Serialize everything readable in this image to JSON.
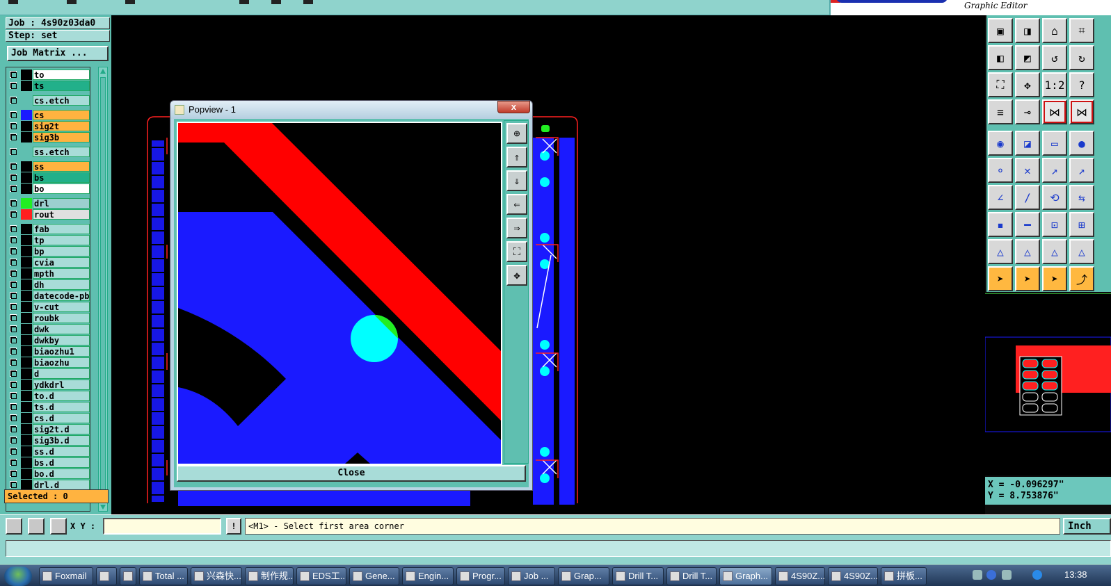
{
  "top": {
    "brand_sub": "Graphic Editor"
  },
  "left_panel": {
    "job": "Job : 4s90z03da0",
    "step": "Step: set",
    "job_matrix": "Job Matrix ...",
    "selected": "Selected : 0",
    "layers": [
      {
        "name": "to",
        "bg": "#ffffff",
        "swatch": "#000000"
      },
      {
        "name": "ts",
        "bg": "#22b08a",
        "swatch": "#000000"
      },
      {
        "name": "cs.etch",
        "bg": "#a8dcd8",
        "swatch": "#5fbfb0"
      },
      {
        "name": "cs",
        "bg": "#ffb340",
        "swatch": "#1a1aff"
      },
      {
        "name": "sig2t",
        "bg": "#ffb340",
        "swatch": "#000000"
      },
      {
        "name": "sig3b",
        "bg": "#ffb340",
        "swatch": "#000000"
      },
      {
        "name": "ss.etch",
        "bg": "#a8dcd8",
        "swatch": "#5fbfb0"
      },
      {
        "name": "ss",
        "bg": "#ffb340",
        "swatch": "#000000"
      },
      {
        "name": "bs",
        "bg": "#22b08a",
        "swatch": "#000000"
      },
      {
        "name": "bo",
        "bg": "#ffffff",
        "swatch": "#000000"
      },
      {
        "name": "drl",
        "bg": "#9ccfcf",
        "swatch": "#22ee22"
      },
      {
        "name": "rout",
        "bg": "#e0e0e0",
        "swatch": "#ff2020"
      },
      {
        "name": "fab",
        "bg": "#a8dcd8",
        "swatch": "#000000"
      },
      {
        "name": "tp",
        "bg": "#a8dcd8",
        "swatch": "#000000"
      },
      {
        "name": "bp",
        "bg": "#a8dcd8",
        "swatch": "#000000"
      },
      {
        "name": "cvia",
        "bg": "#a8dcd8",
        "swatch": "#000000"
      },
      {
        "name": "mpth",
        "bg": "#a8dcd8",
        "swatch": "#000000"
      },
      {
        "name": "dh",
        "bg": "#a8dcd8",
        "swatch": "#000000"
      },
      {
        "name": "datecode-pbc",
        "bg": "#a8dcd8",
        "swatch": "#000000"
      },
      {
        "name": "v-cut",
        "bg": "#a8dcd8",
        "swatch": "#000000"
      },
      {
        "name": "roubk",
        "bg": "#a8dcd8",
        "swatch": "#000000"
      },
      {
        "name": "dwk",
        "bg": "#a8dcd8",
        "swatch": "#000000"
      },
      {
        "name": "dwkby",
        "bg": "#a8dcd8",
        "swatch": "#000000"
      },
      {
        "name": "biaozhu1",
        "bg": "#a8dcd8",
        "swatch": "#000000"
      },
      {
        "name": "biaozhu",
        "bg": "#a8dcd8",
        "swatch": "#000000"
      },
      {
        "name": "d",
        "bg": "#a8dcd8",
        "swatch": "#000000"
      },
      {
        "name": "ydkdrl",
        "bg": "#a8dcd8",
        "swatch": "#000000"
      },
      {
        "name": "to.d",
        "bg": "#a8dcd8",
        "swatch": "#000000"
      },
      {
        "name": "ts.d",
        "bg": "#a8dcd8",
        "swatch": "#000000"
      },
      {
        "name": "cs.d",
        "bg": "#a8dcd8",
        "swatch": "#000000"
      },
      {
        "name": "sig2t.d",
        "bg": "#a8dcd8",
        "swatch": "#000000"
      },
      {
        "name": "sig3b.d",
        "bg": "#a8dcd8",
        "swatch": "#000000"
      },
      {
        "name": "ss.d",
        "bg": "#a8dcd8",
        "swatch": "#000000"
      },
      {
        "name": "bs.d",
        "bg": "#a8dcd8",
        "swatch": "#000000"
      },
      {
        "name": "bo.d",
        "bg": "#a8dcd8",
        "swatch": "#000000"
      },
      {
        "name": "drl.d",
        "bg": "#a8dcd8",
        "swatch": "#000000"
      }
    ]
  },
  "popview": {
    "title": "Popview - 1",
    "close_x": "x",
    "close_button": "Close"
  },
  "right_panel": {
    "coord_x": "X = -0.096297\"",
    "coord_y": "Y = 8.753876\""
  },
  "command": {
    "xy_label": "X Y :",
    "xy_value": "",
    "excl": "!",
    "prompt": "<M1> - Select first area corner",
    "units": "Inch"
  },
  "taskbar": {
    "items": [
      "Foxmail",
      "",
      "",
      "Total ...",
      "兴森快...",
      "制作规...",
      "EDS工...",
      "Gene...",
      "Engin...",
      "Progr...",
      "Job ...",
      "Grap...",
      "Drill T...",
      "Drill T...",
      "Graph...",
      "4S90Z...",
      "4S90Z...",
      "拼板..."
    ],
    "clock": "13:38"
  },
  "colors": {
    "panel": "#5fbfb0",
    "copper_top": "#ff0000",
    "copper_bottom": "#0000ff",
    "drill": "#00ffff",
    "highlight": "#22ee22"
  }
}
